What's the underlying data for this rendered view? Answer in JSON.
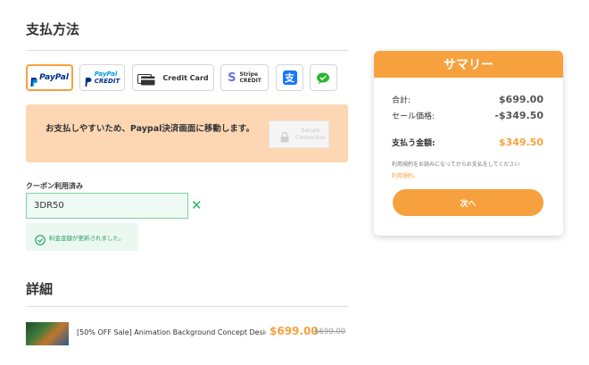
{
  "payment": {
    "title": "支払方法",
    "methods": [
      {
        "id": "paypal",
        "label": "PayPal",
        "selected": true
      },
      {
        "id": "paypal-credit",
        "label_top": "PayPal",
        "label_bottom": "CREDIT"
      },
      {
        "id": "credit-card",
        "label": "Credit Card"
      },
      {
        "id": "stripe-credit",
        "label_top": "Stripe",
        "label_bottom": "CREDIT"
      },
      {
        "id": "alipay",
        "icon": "alipay-icon"
      },
      {
        "id": "wechat",
        "icon": "wechat-icon"
      }
    ],
    "notice": "お支払しやすいため、Paypal決済画面に移動します。",
    "secure_label": "Secure Connection"
  },
  "coupon": {
    "label": "クーポン利用済み",
    "value": "3DR50",
    "message": "料金金額が更新されました。"
  },
  "details": {
    "title": "詳細",
    "product": {
      "name": "[50% OFF Sale] Animation Background Concept Desig...",
      "price": "$699.00",
      "original_price": "$699.00"
    }
  },
  "summary": {
    "title": "サマリー",
    "rows": [
      {
        "label": "合計:",
        "value": "$699.00"
      },
      {
        "label": "セール価格:",
        "value": "-$349.50"
      }
    ],
    "total_label": "支払う金額:",
    "total_value": "$349.50",
    "terms_text": "利用規約をお読みになってからお支払をしてください",
    "terms_link": "利用規約。",
    "next_label": "次へ"
  },
  "colors": {
    "accent": "#f7a13e",
    "success": "#27b56b",
    "notice_bg": "#fdd7b3"
  }
}
